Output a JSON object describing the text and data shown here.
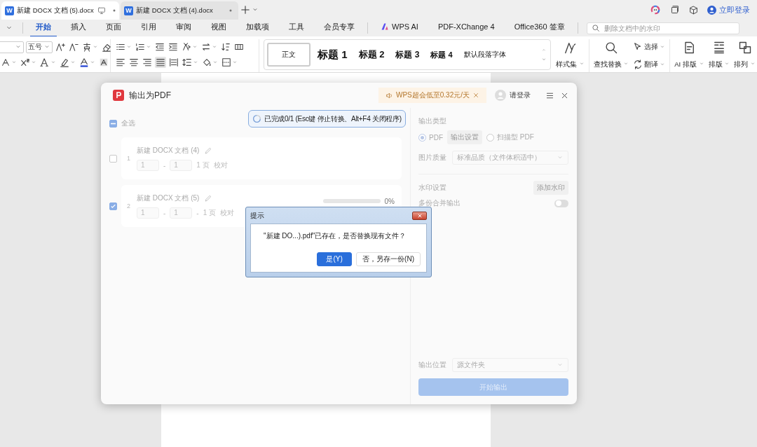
{
  "tabs": [
    {
      "badge": "W",
      "title": "新建 DOCX 文档 (5).docx",
      "selected": true
    },
    {
      "badge": "W",
      "title": "新建 DOCX 文档 (4).docx",
      "selected": false
    }
  ],
  "account": {
    "label": "立即登录"
  },
  "menu": [
    {
      "label": "开始",
      "selected": true
    },
    {
      "label": "插入",
      "selected": false
    },
    {
      "label": "页面",
      "selected": false
    },
    {
      "label": "引用",
      "selected": false
    },
    {
      "label": "审阅",
      "selected": false
    },
    {
      "label": "视图",
      "selected": false
    },
    {
      "label": "加载项",
      "selected": false
    },
    {
      "label": "工具",
      "selected": false
    },
    {
      "label": "会员专享",
      "selected": false
    },
    {
      "label": "WPS AI",
      "selected": false,
      "kind": "ai"
    },
    {
      "label": "PDF-XChange 4",
      "selected": false
    },
    {
      "label": "Office360 签章",
      "selected": false
    }
  ],
  "search": {
    "placeholder": "删除文档中的水印"
  },
  "ribbon": {
    "font_size": "五号",
    "styles": [
      {
        "label": "正文",
        "kind": "body",
        "selected": true
      },
      {
        "label": "标题 1",
        "kind": "h1",
        "selected": false
      },
      {
        "label": "标题 2",
        "kind": "h2",
        "selected": false
      },
      {
        "label": "标题 3",
        "kind": "h3",
        "selected": false
      },
      {
        "label": "标题 4",
        "kind": "h4",
        "selected": false
      },
      {
        "label": "默认段落字体",
        "kind": "char",
        "selected": false
      }
    ],
    "tools": [
      {
        "label": "样式集",
        "kind": "large"
      },
      {
        "label": "查找替换",
        "kind": "large"
      },
      {
        "label": "选择",
        "kind": "small"
      },
      {
        "label": "翻译",
        "kind": "small"
      },
      {
        "label": "AI 排版",
        "kind": "large"
      },
      {
        "label": "排版",
        "kind": "large"
      },
      {
        "label": "排列",
        "kind": "large"
      }
    ]
  },
  "dialog": {
    "title": "输出为PDF",
    "promo": "WPS超会低至0.32元/天",
    "user": "请登录",
    "select_all": {
      "label": "全选",
      "checked": false,
      "indeterminate": true
    },
    "files": [
      {
        "index": "1",
        "name": "新建 DOCX 文档 (4)",
        "checked": false,
        "from": "1",
        "separator": "-",
        "to": "1",
        "pages": "1 页",
        "proofread": "校对"
      },
      {
        "index": "2",
        "name": "新建 DOCX 文档 (5)",
        "checked": true,
        "from": "1",
        "separator": "-",
        "to": "1",
        "dash": "-",
        "pages": "1 页",
        "proofread": "校对",
        "progress": {
          "level": 0,
          "reading": "0%"
        }
      }
    ],
    "toast": "已完成0/1 (Esc键 停止转换、Alt+F4 关闭程序)",
    "output_type": {
      "label": "输出类型",
      "options": [
        {
          "label": "PDF",
          "selected": true
        },
        {
          "label": "扫描型 PDF",
          "selected": false
        }
      ],
      "settings_button": "输出设置"
    },
    "image_quality": {
      "label": "图片质量",
      "value": "标准品质（文件体积适中）"
    },
    "watermark": {
      "label": "水印设置",
      "button": "添加水印"
    },
    "merge": {
      "label": "多份合并输出",
      "on": false
    },
    "output_location": {
      "label": "输出位置",
      "value": "源文件夹"
    },
    "start_button": {
      "label": "开始输出",
      "disabled": true
    }
  },
  "alert": {
    "title": "提示",
    "message": "\"新建 DO...).pdf\"已存在，是否替换现有文件？",
    "buttons": [
      {
        "label": "是(Y)",
        "primary": true
      },
      {
        "label": "否，另存一份(N)",
        "primary": false
      }
    ]
  }
}
